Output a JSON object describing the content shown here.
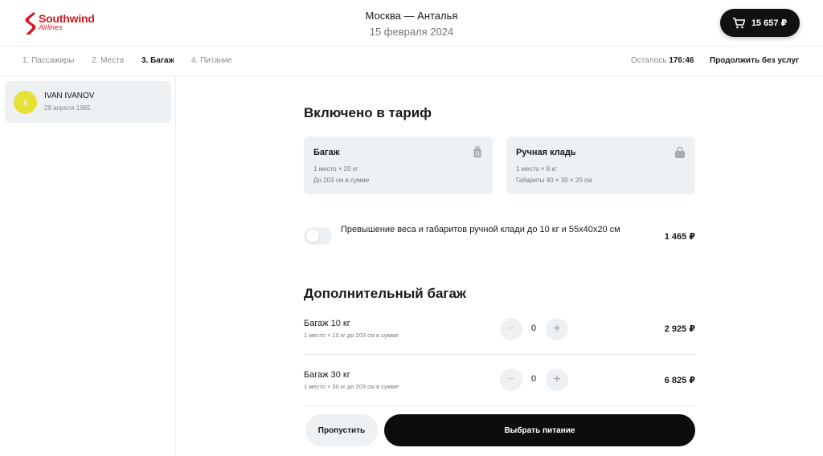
{
  "header": {
    "logo_name": "Southwind",
    "logo_sub": "Airlines",
    "route": "Москва — Анталья",
    "date": "15 февраля 2024",
    "cart_total": "15 657 ₽",
    "brand_color": "#d71920"
  },
  "steps": {
    "items": [
      {
        "label": "1. Пассажиры"
      },
      {
        "label": "2. Места"
      },
      {
        "label": "3. Багаж"
      },
      {
        "label": "4. Питание"
      }
    ],
    "active_index": 2,
    "timer_label": "Осталось",
    "timer_value": "176:46",
    "continue_label": "Продолжить без услуг"
  },
  "passenger": {
    "initials": "II",
    "name": "IVAN IVANOV",
    "dob": "29 апреля 1985",
    "avatar_color": "#e6e234"
  },
  "included": {
    "heading": "Включено в тариф",
    "cards": [
      {
        "title": "Багаж",
        "line1": "1 место × 20 кг",
        "line2": "До 203 см в сумме",
        "icon": "suitcase-icon"
      },
      {
        "title": "Ручная кладь",
        "line1": "1 место × 8 кг",
        "line2": "Габариты 40 × 30 × 20 см",
        "icon": "bag-icon"
      }
    ]
  },
  "excess": {
    "text": "Превышение веса и габаритов ручной клади до 10 кг и 55х40х20 см",
    "price": "1 465 ₽",
    "enabled": false
  },
  "extra": {
    "heading": "Дополнительный багаж",
    "items": [
      {
        "title": "Багаж 10 кг",
        "sub": "1 место × 10 кг до 203 см в сумме",
        "qty": "0",
        "price": "2 925 ₽"
      },
      {
        "title": "Багаж 30 кг",
        "sub": "1 место × 30 кг до 203 см в сумме",
        "qty": "0",
        "price": "6 825 ₽"
      }
    ]
  },
  "footer": {
    "skip_label": "Пропустить",
    "next_label": "Выбрать питание"
  }
}
